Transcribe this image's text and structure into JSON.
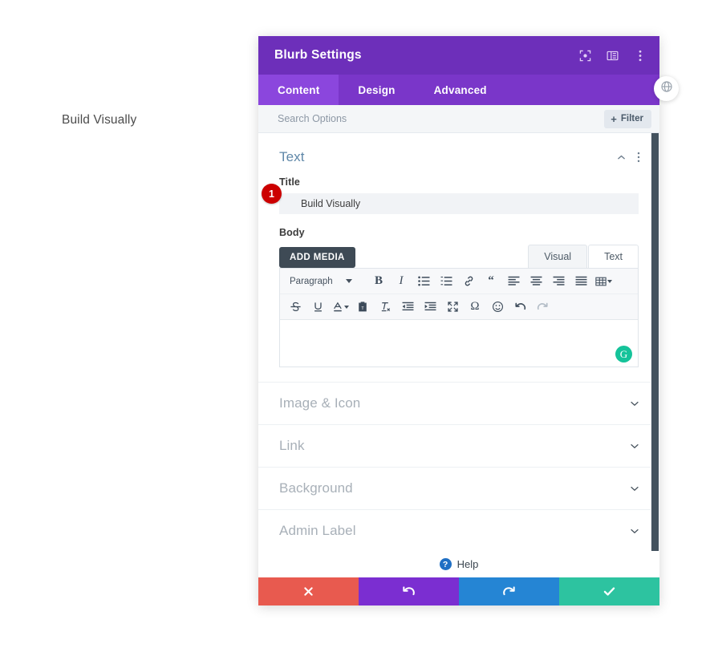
{
  "page": {
    "background_text": "Build Visually"
  },
  "modal": {
    "title": "Blurb Settings",
    "header_icons": [
      {
        "name": "focus-icon"
      },
      {
        "name": "layout-icon"
      },
      {
        "name": "more-vertical-icon"
      }
    ],
    "tabs": [
      {
        "label": "Content",
        "active": true
      },
      {
        "label": "Design",
        "active": false
      },
      {
        "label": "Advanced",
        "active": false
      }
    ],
    "search": {
      "placeholder": "Search Options",
      "value": ""
    },
    "filter_button": {
      "label": "Filter",
      "plus": "+"
    },
    "text_section": {
      "title": "Text",
      "title_field": {
        "label": "Title",
        "value": "Build Visually",
        "badge": "1"
      },
      "body_field": {
        "label": "Body",
        "add_media_label": "ADD MEDIA",
        "editor_tabs": [
          {
            "label": "Visual",
            "selected": true
          },
          {
            "label": "Text",
            "selected": false
          }
        ],
        "format_select": "Paragraph",
        "content": "",
        "grammarly_badge": "G",
        "toolbar_row1": [
          "bold-icon",
          "italic-icon",
          "bulleted-list-icon",
          "numbered-list-icon",
          "link-icon",
          "blockquote-icon",
          "align-left-icon",
          "align-center-icon",
          "align-right-icon",
          "align-justify-icon",
          "table-icon"
        ],
        "toolbar_row2": [
          "strikethrough-icon",
          "underline-icon",
          "text-color-icon",
          "paste-as-text-icon",
          "clear-formatting-icon",
          "outdent-icon",
          "indent-icon",
          "fullscreen-icon",
          "special-character-icon",
          "emoji-icon",
          "undo-icon",
          "redo-icon"
        ]
      }
    },
    "collapsed_sections": [
      {
        "label": "Image & Icon"
      },
      {
        "label": "Link"
      },
      {
        "label": "Background"
      },
      {
        "label": "Admin Label"
      }
    ],
    "help": {
      "label": "Help",
      "icon_char": "?"
    },
    "footer_buttons": [
      {
        "name": "cancel-button",
        "icon": "close-icon",
        "color": "#e85a4f"
      },
      {
        "name": "undo-button",
        "icon": "undo-icon",
        "color": "#7b2ed1"
      },
      {
        "name": "redo-button",
        "icon": "redo-icon",
        "color": "#2585d4"
      },
      {
        "name": "save-button",
        "icon": "check-icon",
        "color": "#2dc3a0"
      }
    ]
  },
  "float_close": {
    "name": "close-circle-button"
  },
  "colors": {
    "header_purple": "#6d2fba",
    "tab_bar_purple": "#7a36c9",
    "active_tab_purple": "#8b46dd",
    "badge_red": "#cc0000",
    "section_title_blue": "#5f87a8",
    "grammarly_green": "#15c39a"
  }
}
